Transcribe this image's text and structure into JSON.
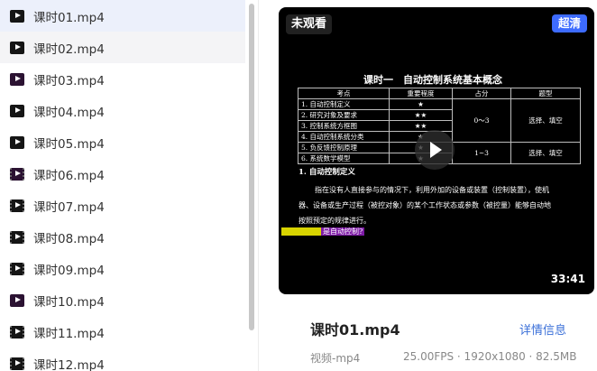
{
  "file_list": {
    "items": [
      {
        "name": "课时01.mp4",
        "selected": true
      },
      {
        "name": "课时02.mp4",
        "hover": true
      },
      {
        "name": "课时03.mp4"
      },
      {
        "name": "课时04.mp4"
      },
      {
        "name": "课时05.mp4"
      },
      {
        "name": "课时06.mp4"
      },
      {
        "name": "课时07.mp4"
      },
      {
        "name": "课时08.mp4"
      },
      {
        "name": "课时09.mp4"
      },
      {
        "name": "课时10.mp4"
      },
      {
        "name": "课时11.mp4"
      },
      {
        "name": "课时12.mp4"
      }
    ]
  },
  "player": {
    "watch_status": "未观看",
    "quality": "超清",
    "duration": "33:41",
    "slide": {
      "title": "课时一　自动控制系统基本概念",
      "table_headers": [
        "考点",
        "重要程度",
        "占分",
        "题型"
      ],
      "rows": [
        {
          "topic": "1. 自动控制定义",
          "importance": "★"
        },
        {
          "topic": "2. 研究对象及要求",
          "importance": "★★"
        },
        {
          "topic": "3. 控制系统方框图",
          "importance": "★★"
        },
        {
          "topic": "4. 自动控制系统分类",
          "importance": "★"
        },
        {
          "topic": "5. 负反馈控制原理",
          "importance": "★"
        },
        {
          "topic": "6. 系统数学模型",
          "importance": "★"
        }
      ],
      "score_a": "0～3",
      "type_a": "选择、填空",
      "score_b": "1~3",
      "type_b": "选择、填空",
      "section_head": "1. 自动控制定义",
      "paragraph_lines": [
        "指在没有人直接参与的情况下，利用外加的设备或装置（控制装置），使机",
        "器、设备或生产过程（被控对象）的某个工作状态或参数（被控量）能够自动地",
        "按照预定的规律进行。"
      ],
      "question_prefix": "精确答题秘",
      "question_text": "是自动控制?"
    }
  },
  "info": {
    "title": "课时01.mp4",
    "detail_link": "详情信息",
    "type": "视频-mp4",
    "spec": "25.00FPS · 1920x1080 · 82.5MB"
  }
}
